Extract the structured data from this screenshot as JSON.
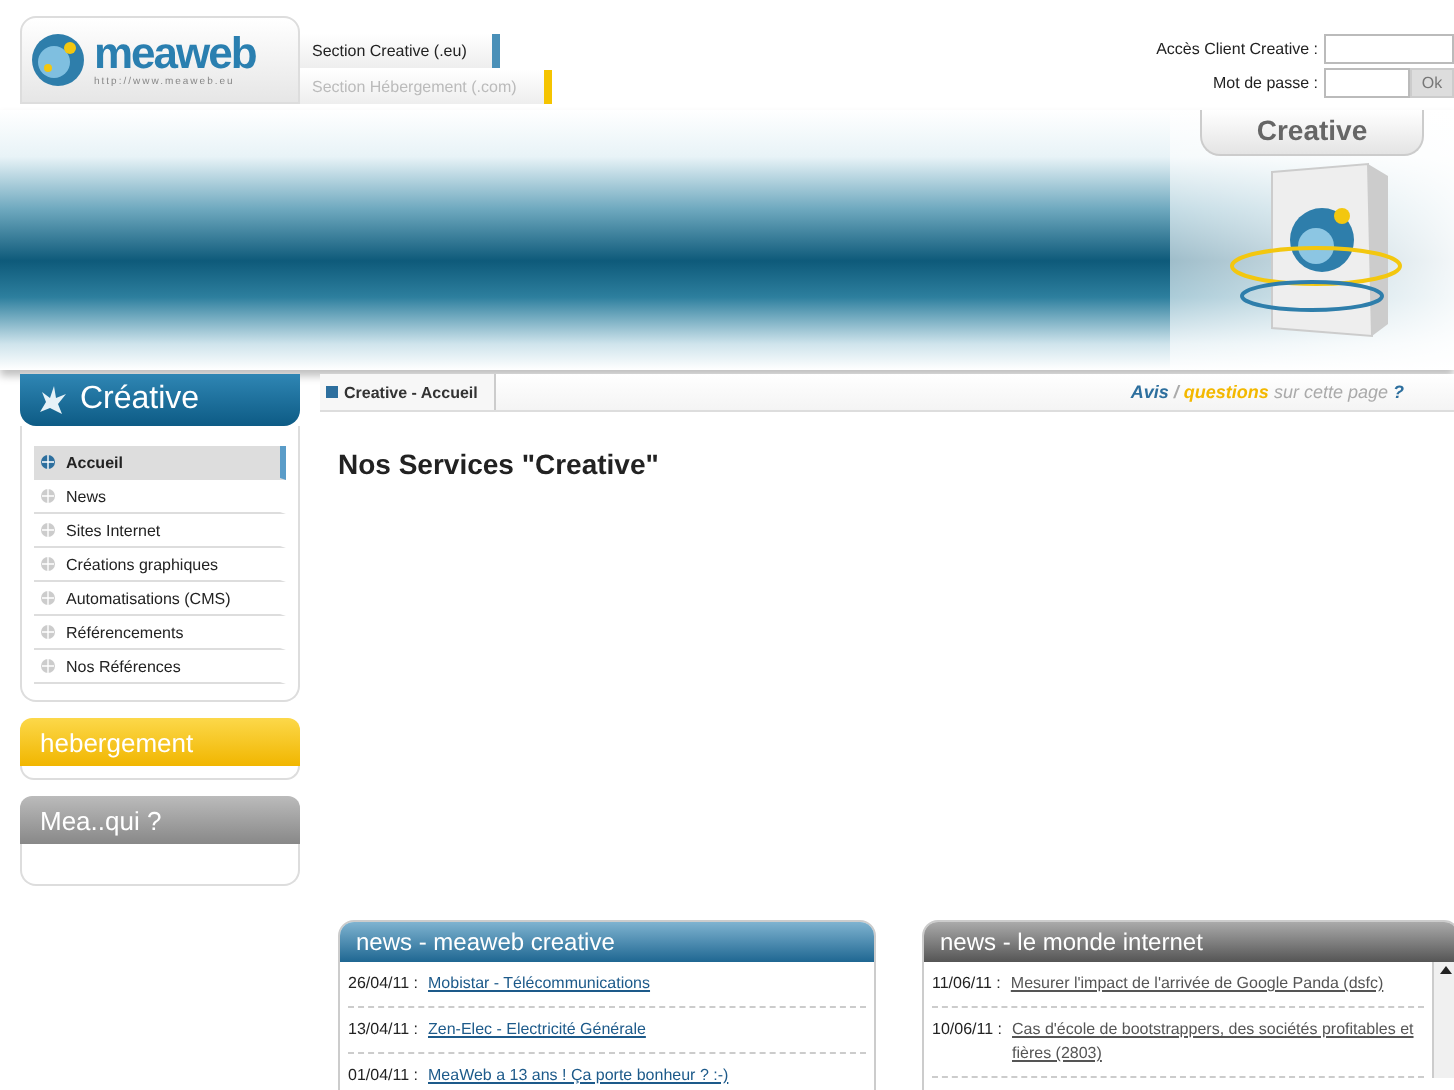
{
  "logo": {
    "name": "meaweb",
    "url": "http://www.meaweb.eu"
  },
  "section_tabs": [
    {
      "label": "Section Creative (.eu)",
      "selected": true,
      "color": "#4a90b8"
    },
    {
      "label": "Section Hébergement (.com)",
      "selected": false,
      "color": "#f5c400"
    }
  ],
  "login": {
    "client_label": "Accès Client Creative :",
    "password_label": "Mot de passe :",
    "button": "Ok"
  },
  "banner": {
    "product_title": "Creative"
  },
  "sidebar": {
    "title": "Créative",
    "items": [
      {
        "label": "Accueil",
        "selected": true
      },
      {
        "label": "News",
        "selected": false
      },
      {
        "label": "Sites Internet",
        "selected": false
      },
      {
        "label": "Créations graphiques",
        "selected": false
      },
      {
        "label": "Automatisations (CMS)",
        "selected": false
      },
      {
        "label": "Référencements",
        "selected": false
      },
      {
        "label": "Nos Références",
        "selected": false
      }
    ],
    "sections": [
      {
        "label": "hebergement",
        "kind": "yellow"
      },
      {
        "label": "Mea..qui ?",
        "kind": "grey"
      }
    ]
  },
  "breadcrumb": "Creative - Accueil",
  "feedback": {
    "avis": "Avis",
    "sep": "/",
    "questions": "questions",
    "rest": "sur cette page",
    "mark": "?"
  },
  "page_title": "Nos Services \"Creative\"",
  "news_panels": [
    {
      "title": "news - meaweb creative",
      "kind": "blue",
      "items": [
        {
          "date": "26/04/11 :",
          "text": "Mobistar - Télécommunications"
        },
        {
          "date": "13/04/11 :",
          "text": "Zen-Elec - Electricité Générale"
        },
        {
          "date": "01/04/11 :",
          "text": "MeaWeb a 13 ans ! Ça porte bonheur ? :-)"
        }
      ]
    },
    {
      "title": "news - le monde internet",
      "kind": "grey",
      "items": [
        {
          "date": "11/06/11 :",
          "text": "Mesurer l'impact de l'arrivée de Google Panda (dsfc)"
        },
        {
          "date": "10/06/11 :",
          "text": "Cas d'école de bootstrappers, des sociétés profitables et fières (2803)"
        }
      ]
    }
  ]
}
